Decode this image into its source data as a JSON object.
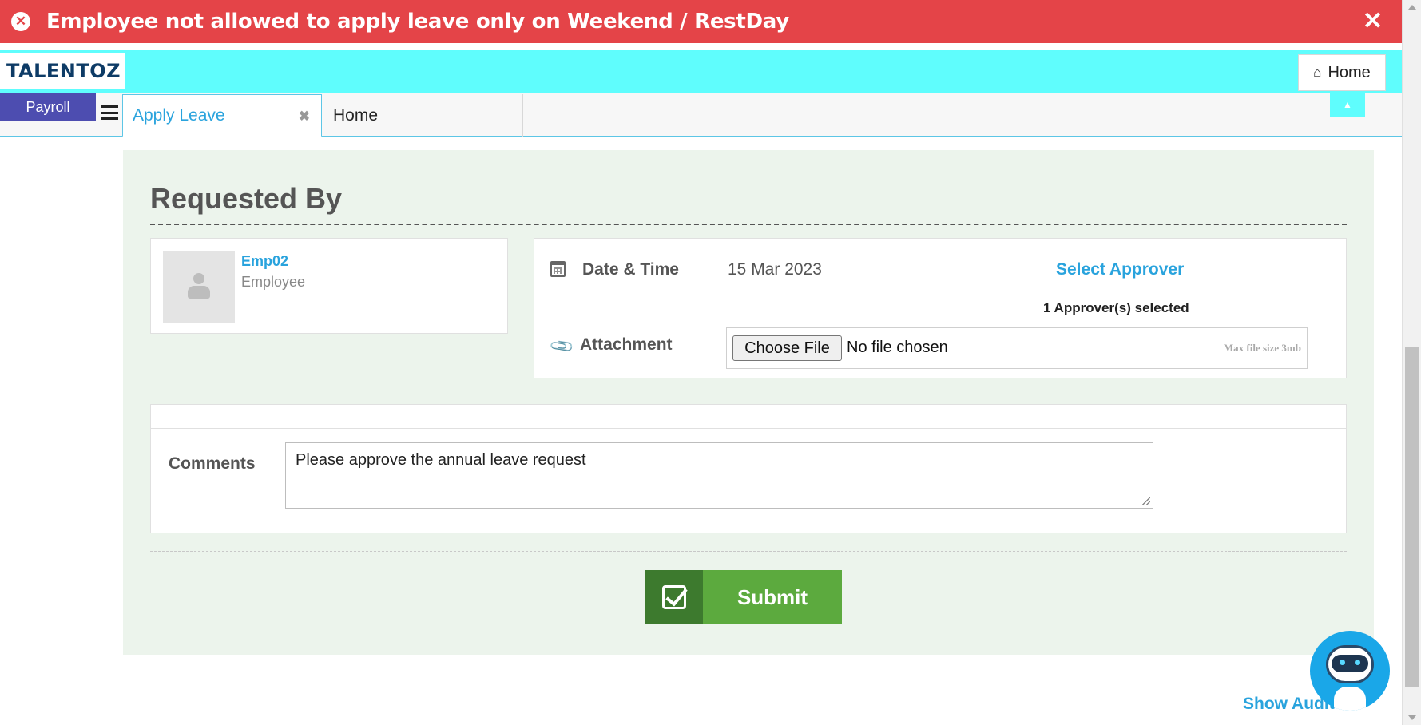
{
  "toast": {
    "message": "Employee not allowed to apply leave only on Weekend / RestDay",
    "icon": "error-circle-icon",
    "close_icon": "close-icon"
  },
  "header": {
    "logo_text": "TALENTOZ",
    "home_label": "Home"
  },
  "tabs": {
    "module": "Payroll",
    "active_tab": "Apply Leave",
    "second_tab": "Home"
  },
  "form": {
    "section_title": "Requested By",
    "employee": {
      "name": "Emp02",
      "role": "Employee"
    },
    "date_label": "Date & Time",
    "date_value": "15 Mar 2023",
    "select_approver": "Select Approver",
    "approver_count": "1 Approver(s) selected",
    "attachment_label": "Attachment",
    "file_button": "Choose File",
    "file_status": "No file chosen",
    "file_max": "Max file size 3mb",
    "comments_label": "Comments",
    "comments_value": "Please approve the annual leave request",
    "submit_label": "Submit"
  },
  "footer": {
    "show_audit": "Show Audit"
  },
  "colors": {
    "toast_bg": "#e44448",
    "header_bg": "#5ffdfd",
    "accent": "#29a3dd",
    "submit_dark": "#3d7a2e",
    "submit_light": "#5caa3e",
    "panel_bg": "#ecf4ec"
  }
}
